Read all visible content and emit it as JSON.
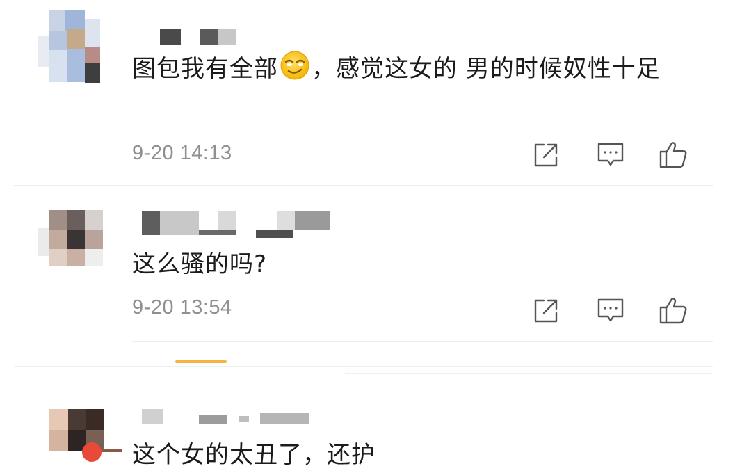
{
  "comments": [
    {
      "text_before_emoji": "图包我有全部",
      "emoji_name": "smirk-face-icon",
      "text_after_emoji": "，感觉这女的  男的时候奴性十足",
      "time": "9-20 14:13"
    },
    {
      "text": "这么骚的吗?",
      "time": "9-20 13:54"
    },
    {
      "text": "这个女的太丑了，还护",
      "time": ""
    }
  ],
  "actions": {
    "share_icon": "share-icon",
    "comment_icon": "comment-icon",
    "like_icon": "like-icon"
  },
  "colors": {
    "text": "#1b1b1b",
    "timestamp": "#8f8f8f",
    "icon": "#555555",
    "divider": "#ececec",
    "highlight": "#f5a623"
  }
}
